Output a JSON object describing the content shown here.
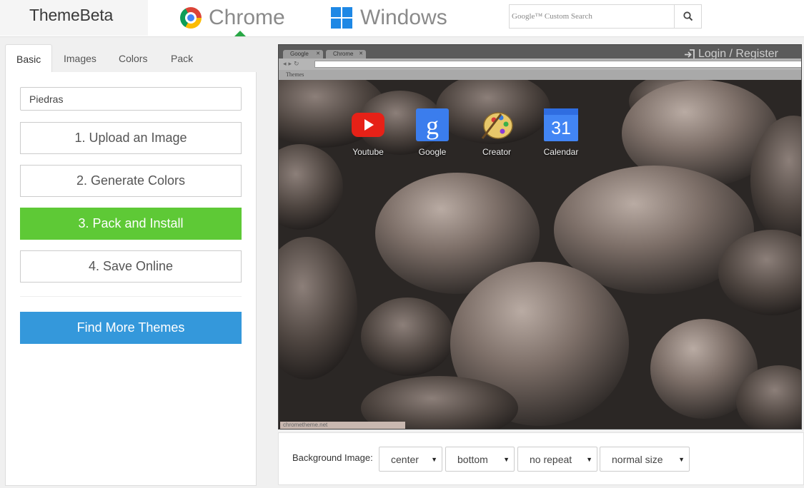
{
  "header": {
    "logo": "ThemeBeta",
    "nav": {
      "chrome": "Chrome",
      "windows": "Windows"
    },
    "search": {
      "placeholder": "Google™ Custom Search"
    },
    "active_color": "#28a745"
  },
  "tabs": [
    "Basic",
    "Images",
    "Colors",
    "Pack"
  ],
  "sidebar": {
    "theme_name": "Piedras",
    "steps": [
      "1. Upload an Image",
      "2. Generate Colors",
      "3. Pack and Install",
      "4. Save Online"
    ],
    "find_more": "Find More Themes",
    "colors": {
      "primary": "#5ec936",
      "secondary": "#3498db"
    }
  },
  "preview": {
    "tabs": [
      "Google",
      "Chrome"
    ],
    "login": "Login / Register",
    "bookmark": "Themes",
    "apps": [
      {
        "label": "Youtube",
        "icon": "youtube-icon"
      },
      {
        "label": "Google",
        "icon": "google-icon"
      },
      {
        "label": "Creator",
        "icon": "palette-icon"
      },
      {
        "label": "Calendar",
        "icon": "calendar-icon"
      }
    ],
    "calendar_day": "31",
    "watermark": "chrometheme.net"
  },
  "background_options": {
    "label": "Background Image:",
    "position_x": "center",
    "position_y": "bottom",
    "repeat": "no repeat",
    "size": "normal size"
  }
}
